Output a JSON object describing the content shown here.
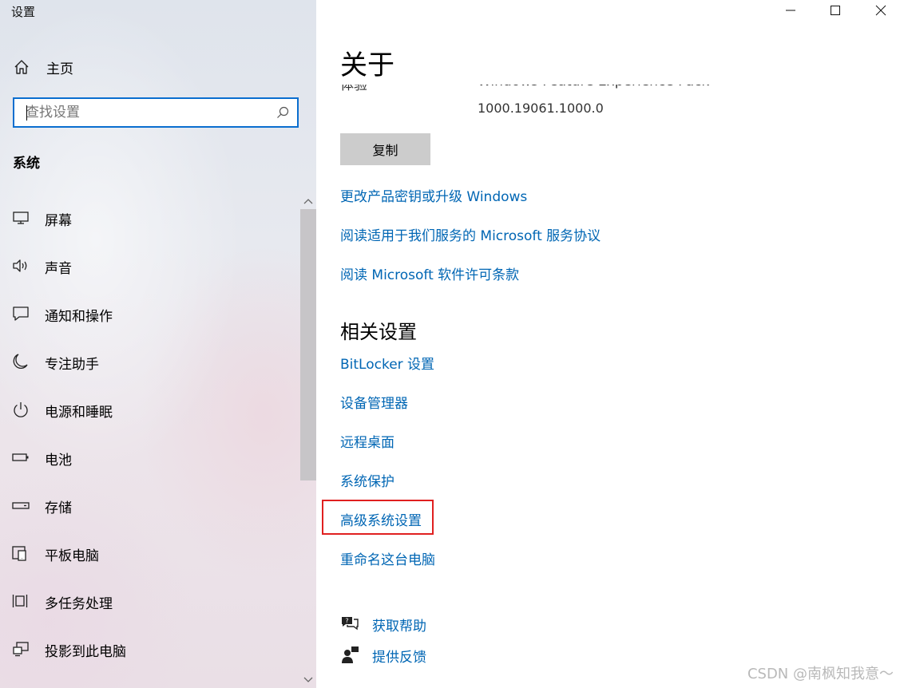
{
  "app_title": "设置",
  "sidebar": {
    "home_label": "主页",
    "search": {
      "placeholder": "查找设置",
      "value": ""
    },
    "section_title": "系统",
    "items": [
      {
        "label": "屏幕",
        "icon": "monitor-icon"
      },
      {
        "label": "声音",
        "icon": "speaker-icon"
      },
      {
        "label": "通知和操作",
        "icon": "notification-icon"
      },
      {
        "label": "专注助手",
        "icon": "moon-icon"
      },
      {
        "label": "电源和睡眠",
        "icon": "power-icon"
      },
      {
        "label": "电池",
        "icon": "battery-icon"
      },
      {
        "label": "存储",
        "icon": "storage-icon"
      },
      {
        "label": "平板电脑",
        "icon": "tablet-icon"
      },
      {
        "label": "多任务处理",
        "icon": "multitasking-icon"
      },
      {
        "label": "投影到此电脑",
        "icon": "project-icon"
      }
    ]
  },
  "window_controls": [
    "minimize",
    "maximize",
    "close"
  ],
  "main": {
    "page_title": "关于",
    "clipped_row": {
      "key": "体验",
      "value": "Windows Feature Experience Pack"
    },
    "version_value": "1000.19061.1000.0",
    "copy_button_label": "复制",
    "links": [
      "更改产品密钥或升级 Windows",
      "阅读适用于我们服务的 Microsoft 服务协议",
      "阅读 Microsoft 软件许可条款"
    ],
    "related_title": "相关设置",
    "related_links": [
      "BitLocker 设置",
      "设备管理器",
      "远程桌面",
      "系统保护",
      "高级系统设置",
      "重命名这台电脑"
    ],
    "help_links": [
      {
        "label": "获取帮助",
        "icon": "help-chat-icon"
      },
      {
        "label": "提供反馈",
        "icon": "feedback-icon"
      }
    ]
  },
  "watermark": "CSDN @南枫知我意～",
  "colors": {
    "accent": "#0a6ecf",
    "link": "#0066b4",
    "highlight": "#e02020"
  }
}
